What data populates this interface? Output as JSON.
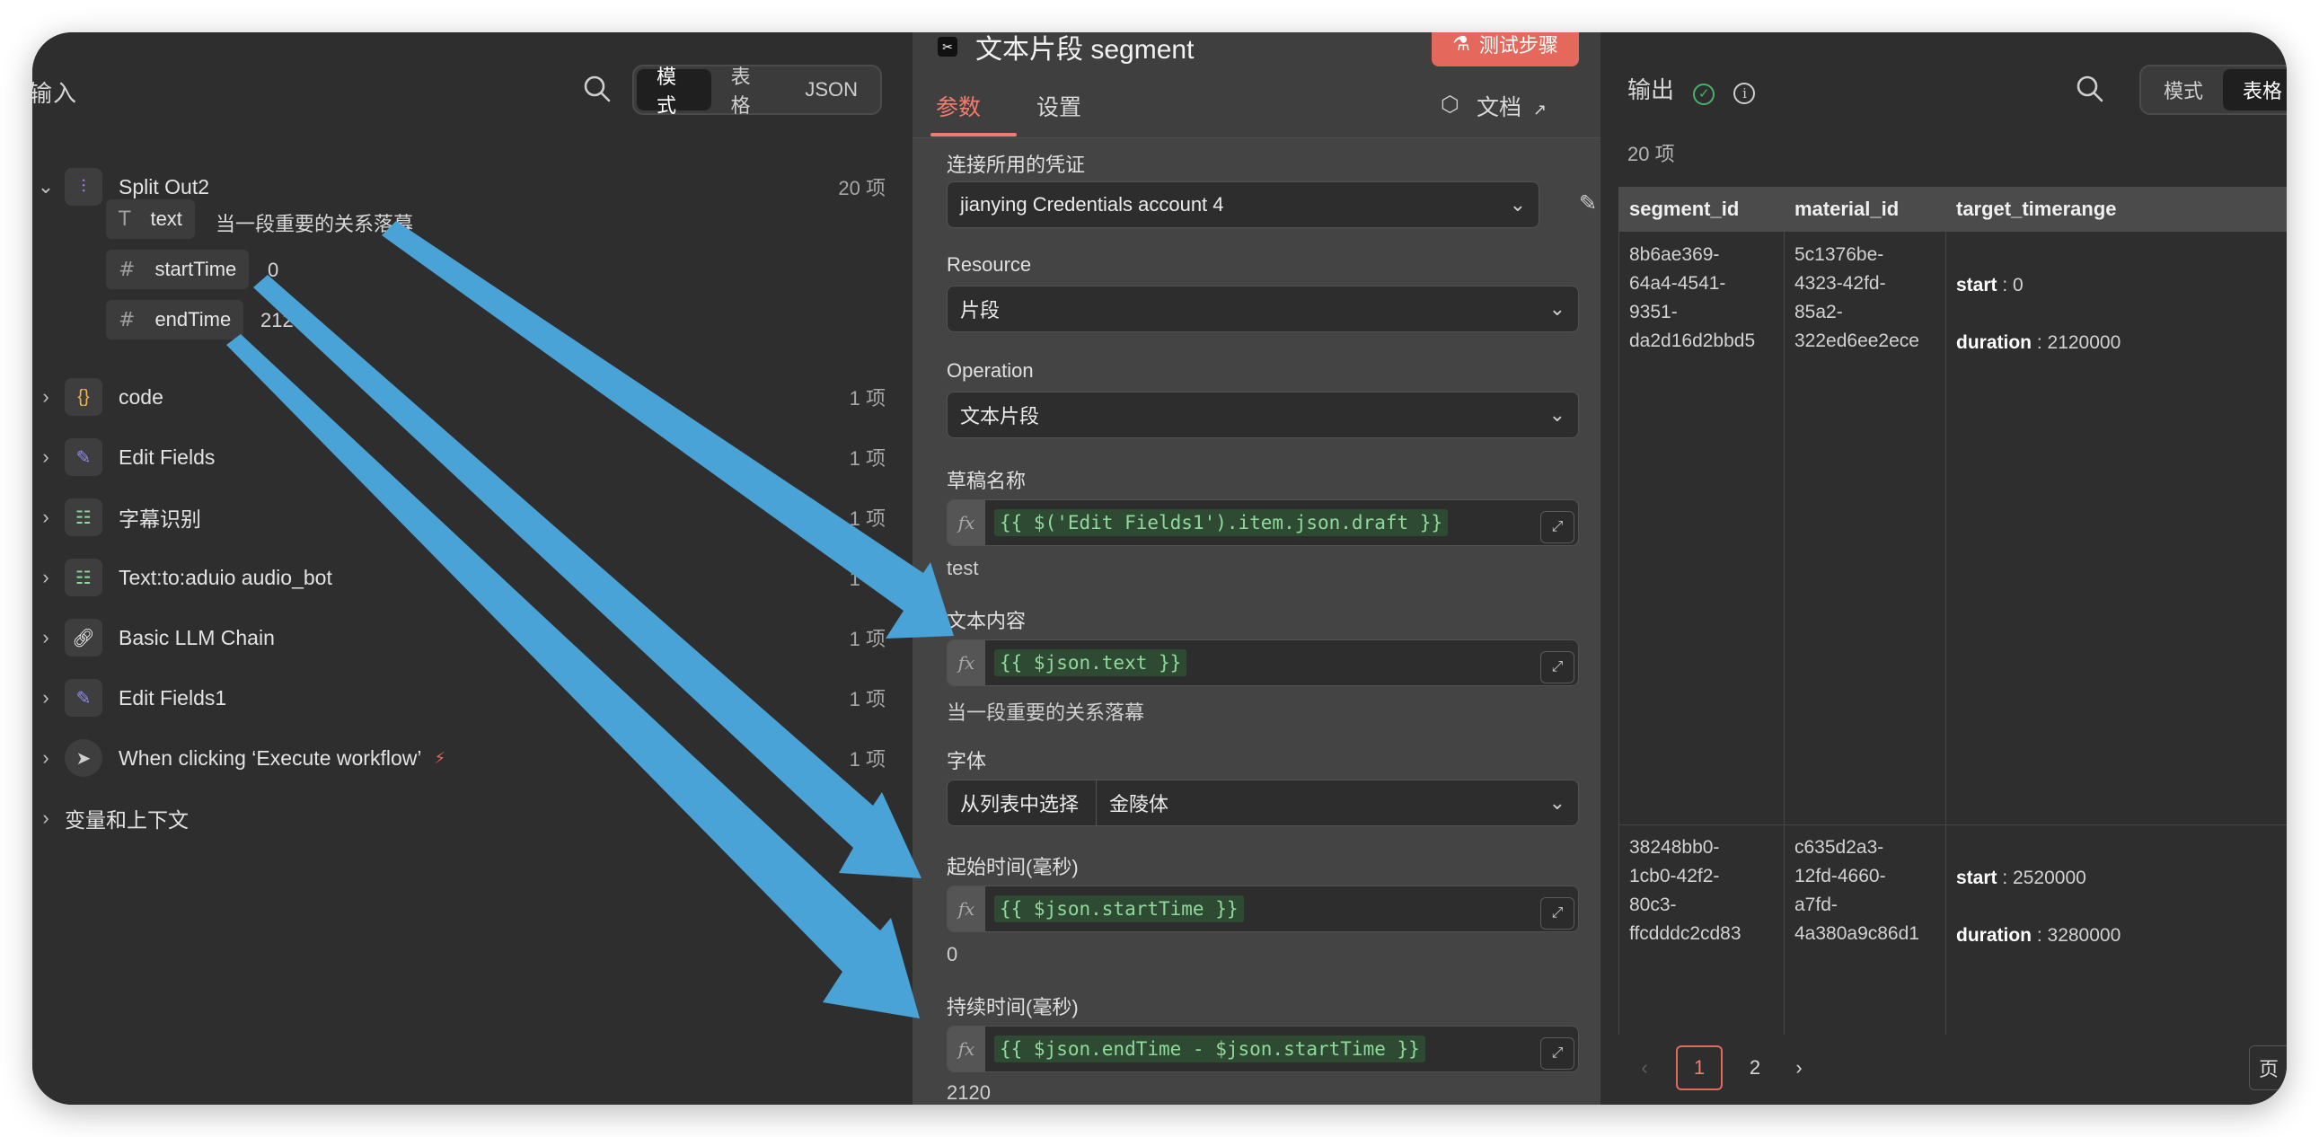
{
  "input": {
    "title": "输入",
    "view_modes": [
      "模式",
      "表格",
      "JSON"
    ],
    "active_mode": "模式",
    "tree": [
      {
        "label": "Split Out2",
        "count": "20 项",
        "icon": "split-icon",
        "expanded": true
      },
      {
        "label": "code",
        "count": "1 项",
        "icon": "code-braces-icon"
      },
      {
        "label": "Edit Fields",
        "count": "1 项",
        "icon": "pencil-icon"
      },
      {
        "label": "字幕识别",
        "count": "1 项",
        "icon": "robot-icon"
      },
      {
        "label": "Text:to:aduio audio_bot",
        "count": "1 项",
        "icon": "robot-icon"
      },
      {
        "label": "Basic LLM Chain",
        "count": "1 项",
        "icon": "link-icon"
      },
      {
        "label": "Edit Fields1",
        "count": "1 项",
        "icon": "pencil-icon"
      },
      {
        "label": "When clicking ‘Execute workflow’",
        "count": "1 项",
        "icon": "cursor-icon"
      },
      {
        "label": "变量和上下文",
        "count": "",
        "icon": ""
      }
    ],
    "fields": [
      {
        "type": "T",
        "name": "text",
        "value": "当一段重要的关系落幕"
      },
      {
        "type": "#",
        "name": "startTime",
        "value": "0"
      },
      {
        "type": "#",
        "name": "endTime",
        "value": "2120"
      }
    ]
  },
  "node": {
    "title": "文本片段 segment",
    "test_button": "测试步骤",
    "tabs": [
      "参数",
      "设置"
    ],
    "docs": "文档",
    "params": {
      "credential_label": "连接所用的凭证",
      "credential_value": "jianying Credentials account 4",
      "resource_label": "Resource",
      "resource_value": "片段",
      "operation_label": "Operation",
      "operation_value": "文本片段",
      "draft_label": "草稿名称",
      "draft_expr": "{{ $('Edit Fields1').item.json.draft }}",
      "draft_result": "test",
      "text_label": "文本内容",
      "text_expr": "{{ $json.text }}",
      "text_result": "当一段重要的关系落幕",
      "font_label": "字体",
      "font_mode": "从列表中选择",
      "font_value": "金陵体",
      "start_label": "起始时间(毫秒)",
      "start_expr": "{{ $json.startTime }}",
      "start_result": "0",
      "duration_label": "持续时间(毫秒)",
      "duration_expr": "{{ $json.endTime - $json.startTime }}",
      "duration_result": "2120"
    }
  },
  "output": {
    "title": "输出",
    "view_modes": [
      "模式",
      "表格"
    ],
    "active_mode": "表格",
    "count": "20 项",
    "columns": [
      "segment_id",
      "material_id",
      "target_timerange"
    ],
    "rows": [
      {
        "segment_id": "8b6ae369-\n64a4-4541-\n9351-\nda2d16d2bbd5",
        "material_id": "5c1376be-\n4323-42fd-\n85a2-\n322ed6ee2ece",
        "start_key": "start",
        "start": "0",
        "duration_key": "duration",
        "duration": "2120000"
      },
      {
        "segment_id": "38248bb0-\n1cb0-42f2-\n80c3-\nffcdddc2cd83",
        "material_id": "c635d2a3-\n12fd-4660-\na7fd-\n4a380a9c86d1",
        "start_key": "start",
        "start": "2520000",
        "duration_key": "duration",
        "duration": "3280000"
      }
    ],
    "pages": [
      "1",
      "2"
    ],
    "current_page": "1",
    "page_suffix": "页"
  },
  "colors": {
    "accent": "#ef7d6f",
    "arrow": "#4aa3d6",
    "expression_bg": "#2f4a33",
    "expression_text": "#8fd99b"
  }
}
